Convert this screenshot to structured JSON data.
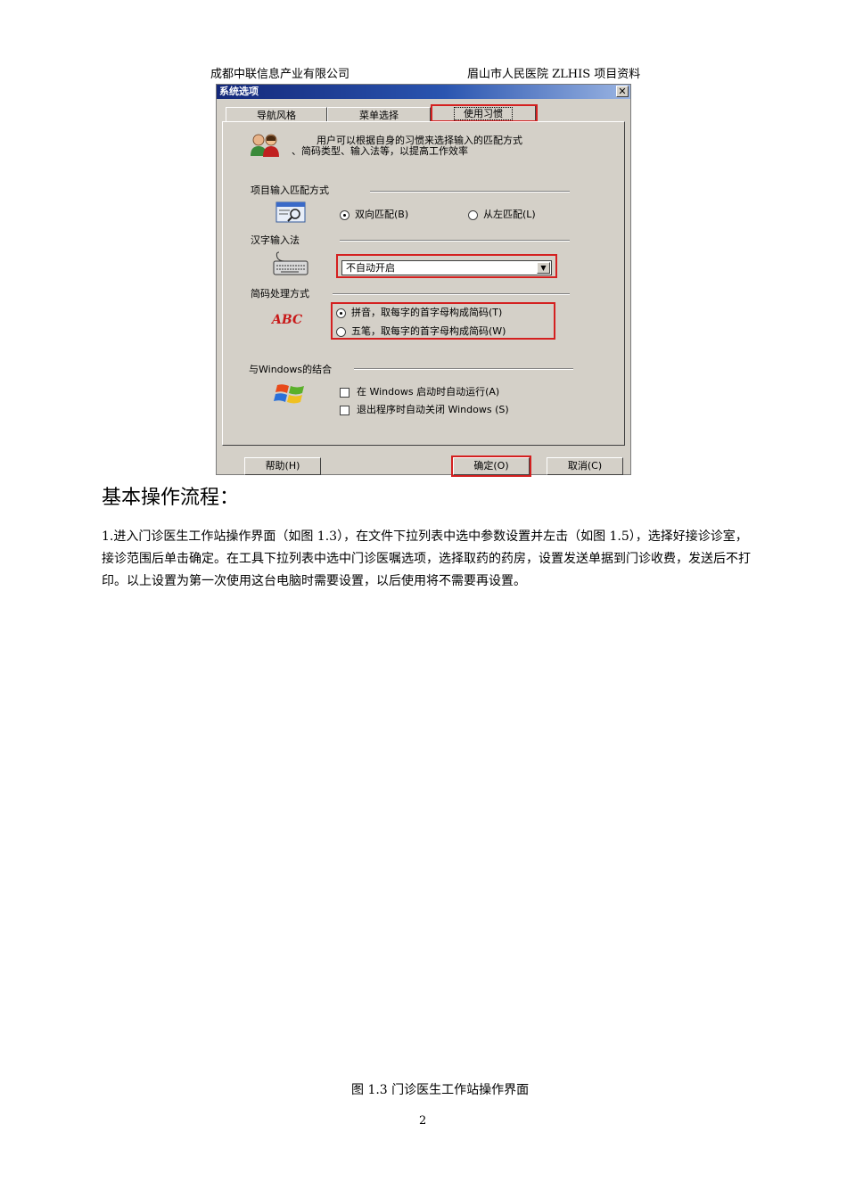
{
  "header": {
    "left": "成都中联信息产业有限公司",
    "right": "眉山市人民医院 ZLHIS 项目资料"
  },
  "dialog": {
    "title": "系统选项",
    "close_glyph": "✕",
    "tabs": [
      "导航风格",
      "菜单选择",
      "使用习惯"
    ],
    "intro_line1": "用户可以根据自身的习惯来选择输入的匹配方式",
    "intro_line2": "、简码类型、输入法等，以提高工作效率",
    "match_section": "项目输入匹配方式",
    "match_options": [
      "双向匹配(B)",
      "从左匹配(L)"
    ],
    "ime_section": "汉字输入法",
    "ime_value": "不自动开启",
    "code_section": "简码处理方式",
    "code_options": [
      "拼音，取每字的首字母构成简码(T)",
      "五笔，取每字的首字母构成简码(W)"
    ],
    "abc_logo": "ABC",
    "windows_section": "与Windows的结合",
    "windows_options": [
      "在 Windows 启动时自动运行(A)",
      "退出程序时自动关闭 Windows (S)"
    ],
    "buttons": {
      "help": "帮助(H)",
      "ok": "确定(O)",
      "cancel": "取消(C)"
    },
    "colors": {
      "highlight": "#d42020",
      "titlebar": "#14287a"
    }
  },
  "heading": "基本操作流程：",
  "body_text": "1.进入门诊医生工作站操作界面（如图 1.3），在文件下拉列表中选中参数设置并左击（如图 1.5），选择好接诊诊室，接诊范围后单击确定。在工具下拉列表中选中门诊医嘱选项，选择取药的药房，设置发送单据到门诊收费，发送后不打印。以上设置为第一次使用这台电脑时需要设置，以后使用将不需要再设置。",
  "caption": "图 1.3 门诊医生工作站操作界面",
  "page_number": "2"
}
